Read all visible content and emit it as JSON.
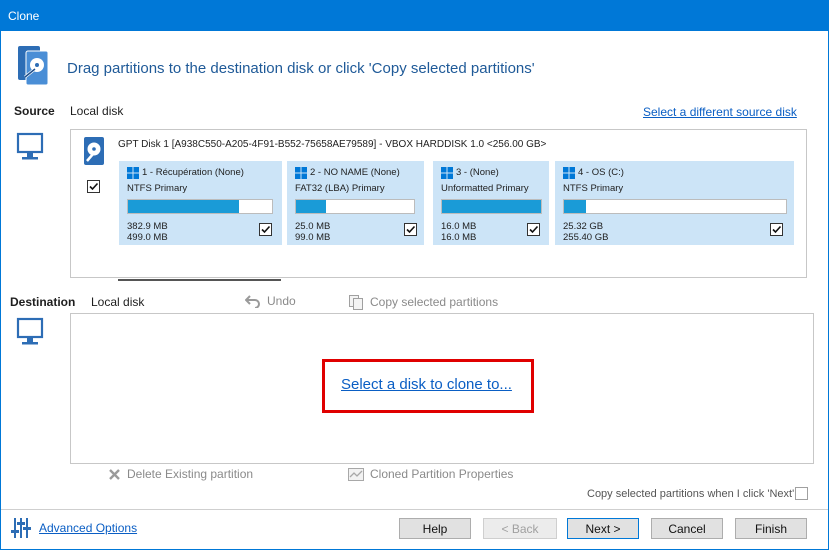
{
  "window": {
    "title": "Clone"
  },
  "header": {
    "instruction": "Drag partitions to the destination disk or click 'Copy selected partitions'"
  },
  "source": {
    "label": "Source",
    "disk_type": "Local disk",
    "change_link": "Select a different source disk",
    "disk_title": "GPT Disk 1 [A938C550-A205-4F91-B552-75658AE79589] - VBOX HARDDISK 1.0  <256.00 GB>",
    "partitions": [
      {
        "name": "1 - Récupération (None)",
        "type": "NTFS Primary",
        "used": "382.9 MB",
        "total": "499.0 MB",
        "fill": 0.77
      },
      {
        "name": "2 - NO NAME (None)",
        "type": "FAT32 (LBA) Primary",
        "used": "25.0 MB",
        "total": "99.0 MB",
        "fill": 0.25
      },
      {
        "name": "3 -  (None)",
        "type": "Unformatted Primary",
        "used": "16.0 MB",
        "total": "16.0 MB",
        "fill": 1.0
      },
      {
        "name": "4 - OS (C:)",
        "type": "NTFS Primary",
        "used": "25.32 GB",
        "total": "255.40 GB",
        "fill": 0.1
      }
    ]
  },
  "destination": {
    "label": "Destination",
    "disk_type": "Local disk",
    "undo": "Undo",
    "copy_selected": "Copy selected partitions",
    "select_disk_link": "Select a disk to clone to..."
  },
  "actions": {
    "delete_partition": "Delete Existing partition",
    "cloned_properties": "Cloned Partition Properties",
    "copy_note": "Copy selected partitions when I click 'Next'"
  },
  "footer": {
    "advanced": "Advanced Options",
    "help": "Help",
    "back": "< Back",
    "next": "Next >",
    "cancel": "Cancel",
    "finish": "Finish"
  },
  "colors": {
    "accent": "#0078d7",
    "partition_bg": "#cce4f7",
    "bar_fill": "#1a9bd7",
    "highlight": "#e00000"
  }
}
